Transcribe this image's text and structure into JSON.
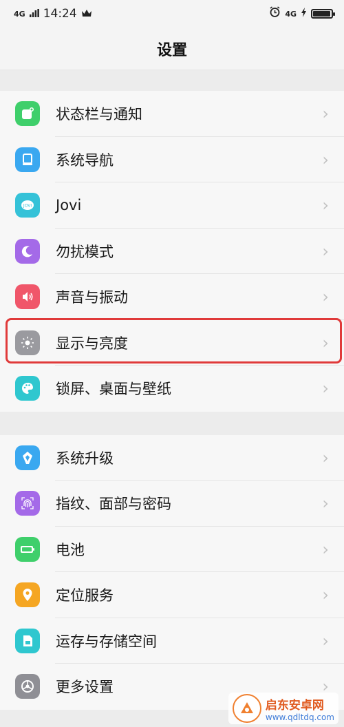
{
  "status_bar": {
    "signal": "4G",
    "time": "14:24",
    "right_signal": "4G",
    "battery_level": 0.95
  },
  "header": {
    "title": "设置"
  },
  "groups": [
    {
      "items": [
        {
          "label": "状态栏与通知",
          "icon": "notification-icon",
          "color": "#3fcf6b"
        },
        {
          "label": "系统导航",
          "icon": "navigation-icon",
          "color": "#3aa8f0"
        },
        {
          "label": "Jovi",
          "icon": "jovi-icon",
          "color": "#35c2d8"
        },
        {
          "label": "勿扰模式",
          "icon": "moon-icon",
          "color": "#a46ae8"
        },
        {
          "label": "声音与振动",
          "icon": "speaker-icon",
          "color": "#f0566a"
        },
        {
          "label": "显示与亮度",
          "icon": "brightness-icon",
          "color": "#9a9a9f"
        },
        {
          "label": "锁屏、桌面与壁纸",
          "icon": "palette-icon",
          "color": "#2fc7cf"
        }
      ]
    },
    {
      "items": [
        {
          "label": "系统升级",
          "icon": "upgrade-icon",
          "color": "#3aa8f0"
        },
        {
          "label": "指纹、面部与密码",
          "icon": "fingerprint-icon",
          "color": "#a46ae8"
        },
        {
          "label": "电池",
          "icon": "battery-icon",
          "color": "#3fcf6b"
        },
        {
          "label": "定位服务",
          "icon": "location-icon",
          "color": "#f5a623"
        },
        {
          "label": "运存与存储空间",
          "icon": "storage-icon",
          "color": "#2fc7cf"
        },
        {
          "label": "更多设置",
          "icon": "gear-icon",
          "color": "#8f8f95"
        }
      ]
    }
  ],
  "highlight_color": "#e03a3a",
  "watermark": {
    "title": "启东安卓网",
    "url": "www.qdltdq.com"
  }
}
